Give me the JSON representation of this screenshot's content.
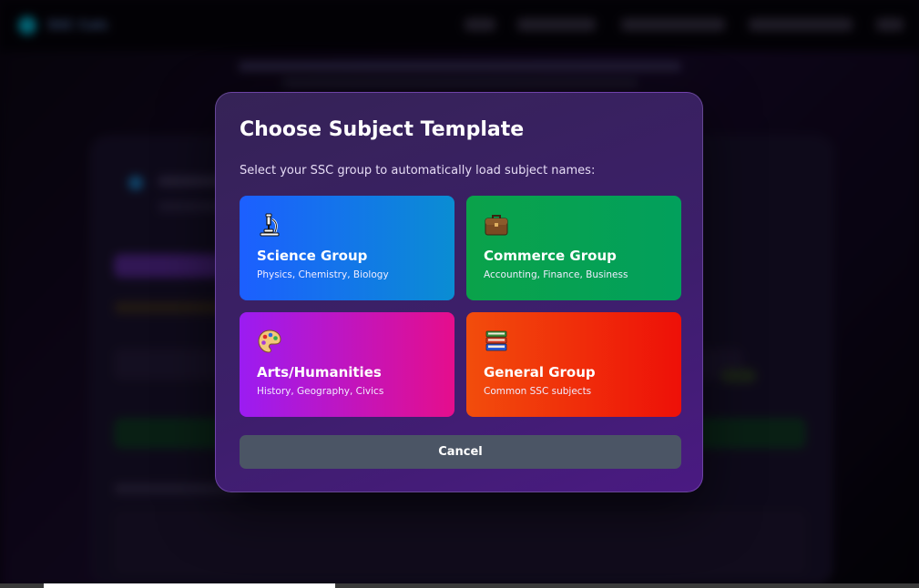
{
  "background_app": {
    "logo_text": "SSC Calc"
  },
  "modal": {
    "title": "Choose Subject Template",
    "subtitle": "Select your SSC group to automatically load subject names:",
    "groups": [
      {
        "title": "Science Group",
        "subjects": "Physics, Chemistry, Biology",
        "icon": "microscope-icon"
      },
      {
        "title": "Commerce Group",
        "subjects": "Accounting, Finance, Business",
        "icon": "briefcase-icon"
      },
      {
        "title": "Arts/Humanities",
        "subjects": "History, Geography, Civics",
        "icon": "palette-icon"
      },
      {
        "title": "General Group",
        "subjects": "Common SSC subjects",
        "icon": "books-icon"
      }
    ],
    "cancel_label": "Cancel"
  },
  "colors": {
    "science": "#1c5fff",
    "commerce": "#0aa24a",
    "arts": "#9b1cf2",
    "general": "#f24d0c",
    "cancel": "#4b5565"
  }
}
